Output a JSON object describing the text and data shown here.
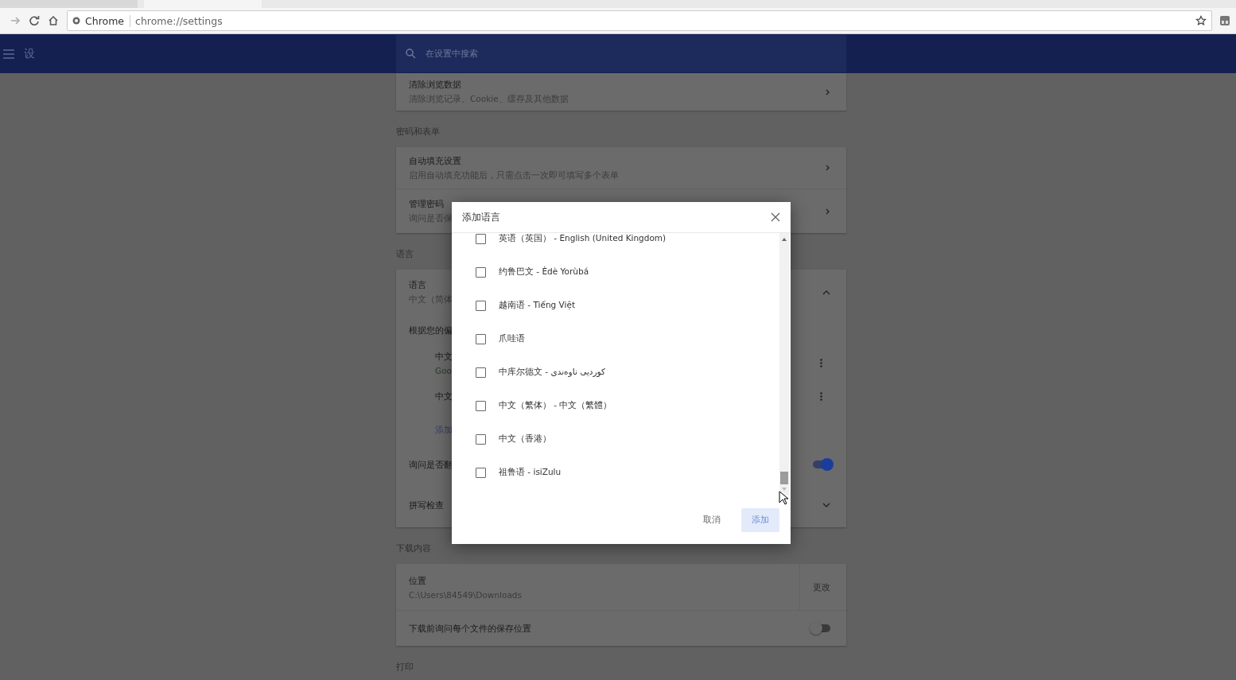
{
  "browser": {
    "address": {
      "site_label": "Chrome",
      "url": "chrome://settings"
    }
  },
  "header": {
    "title": "设",
    "search_placeholder": "在设置中搜索"
  },
  "sections": [
    {
      "rows": [
        {
          "kind": "nav",
          "title": "清除浏览数据",
          "subtitle": "清除浏览记录、Cookie、缓存及其他数据"
        }
      ]
    },
    {
      "heading": "密码和表单",
      "rows": [
        {
          "kind": "nav",
          "title": "自动填充设置",
          "subtitle": "启用自动填充功能后，只需点击一次即可填写多个表单"
        },
        {
          "kind": "nav",
          "title": "管理密码",
          "subtitle": "询问是否保"
        }
      ]
    },
    {
      "heading": "语言",
      "rows": [
        {
          "kind": "expand",
          "title": "语言",
          "subtitle": "中文（简体",
          "expanded": true
        },
        {
          "kind": "label",
          "title": "根据您的偏"
        },
        {
          "kind": "language",
          "title": "中文",
          "subtitle": "Goo"
        },
        {
          "kind": "language",
          "title": "中文"
        },
        {
          "kind": "link",
          "title": "添加"
        },
        {
          "kind": "toggle",
          "title": "询问是否翻",
          "on": true
        },
        {
          "kind": "expand",
          "title": "拼写检查",
          "expanded": false
        }
      ]
    },
    {
      "heading": "下载内容",
      "rows": [
        {
          "kind": "action",
          "title": "位置",
          "subtitle": "C:\\Users\\84549\\Downloads",
          "action": "更改"
        },
        {
          "kind": "toggle",
          "title": "下载前询问每个文件的保存位置",
          "on": false
        }
      ]
    },
    {
      "heading": "打印"
    }
  ],
  "dialog": {
    "title": "添加语言",
    "options": [
      {
        "label": "英语（英国） - English (United Kingdom)",
        "checked": false
      },
      {
        "label": "约鲁巴文 - Èdè Yorùbá",
        "checked": false
      },
      {
        "label": "越南语 - Tiếng Việt",
        "checked": false
      },
      {
        "label": "爪哇语",
        "checked": false
      },
      {
        "label": "中库尔德文 - کوردیی ناوەندی",
        "checked": false
      },
      {
        "label": "中文（繁体） - 中文（繁體）",
        "checked": false
      },
      {
        "label": "中文（香港）",
        "checked": false
      },
      {
        "label": "祖鲁语 - isiZulu",
        "checked": false
      }
    ],
    "cancel": "取消",
    "add": {
      "label": "添加",
      "disabled": true
    }
  }
}
